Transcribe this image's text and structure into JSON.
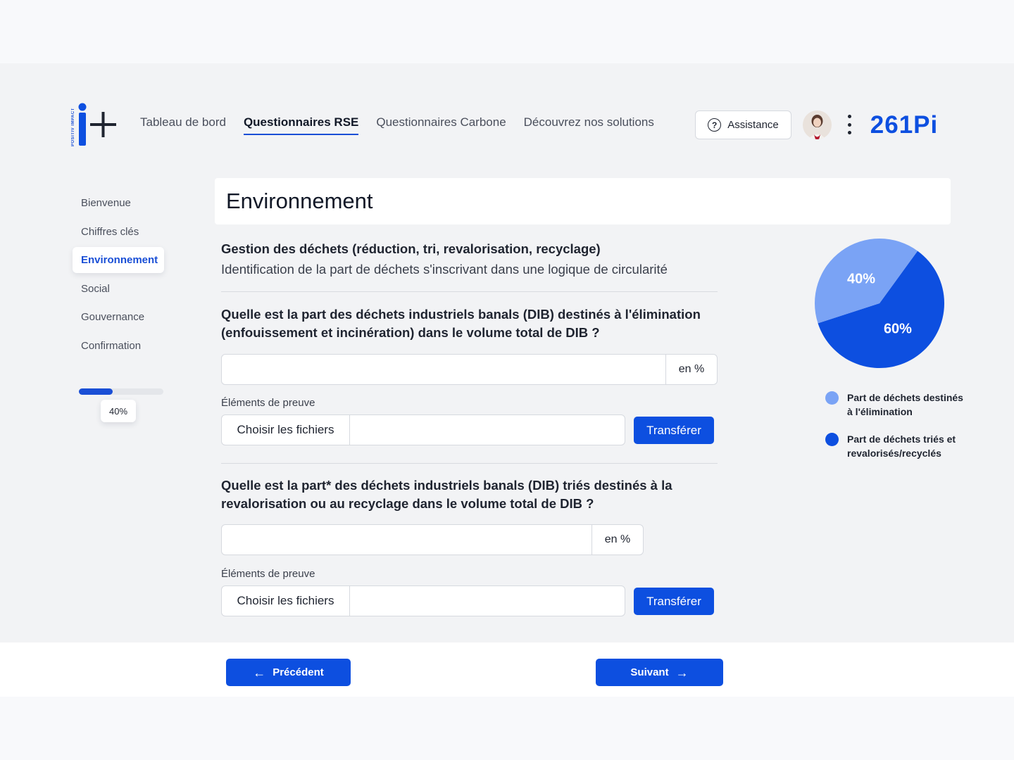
{
  "header": {
    "logo_small_text": "POSITIV IMPACT",
    "nav": [
      {
        "label": "Tableau de bord"
      },
      {
        "label": "Questionnaires RSE"
      },
      {
        "label": "Questionnaires Carbone"
      },
      {
        "label": "Découvrez nos solutions"
      }
    ],
    "active_nav": "Questionnaires RSE",
    "assistance_label": "Assistance",
    "help_icon_glyph": "?",
    "brand_text": "261Pi"
  },
  "sidebar": {
    "items": [
      {
        "label": "Bienvenue"
      },
      {
        "label": "Chiffres clés"
      },
      {
        "label": "Environnement"
      },
      {
        "label": "Social"
      },
      {
        "label": "Gouvernance"
      },
      {
        "label": "Confirmation"
      }
    ],
    "active_item": "Environnement",
    "progress_value": 0.4,
    "progress_label": "40%"
  },
  "main": {
    "title": "Environnement",
    "section_heading": "Gestion des déchets (réduction, tri, revalorisation, recyclage)",
    "section_subtitle": "Identification de la part de déchets s'inscrivant dans une logique de circularité",
    "questions": [
      {
        "text": "Quelle est la part des déchets industriels banals (DIB) destinés à l'élimination (enfouissement et incinération) dans le volume total de DIB ?",
        "input_value": "",
        "unit": "en %",
        "proof_label": "Éléments de preuve",
        "file_button": "Choisir les fichiers",
        "file_value": "",
        "transfer_label": "Transférer"
      },
      {
        "text": "Quelle est la part* des déchets industriels banals (DIB) triés destinés à la revalorisation ou au recyclage dans le volume total de DIB ?",
        "input_value": "",
        "unit": "en %",
        "proof_label": "Éléments de preuve",
        "file_button": "Choisir les fichiers",
        "file_value": "",
        "transfer_label": "Transférer"
      }
    ]
  },
  "chart_data": {
    "type": "pie",
    "title": "",
    "categories": [
      "Part de déchets destinés à l'élimination",
      "Part de déchets triés et revalorisés/recyclés"
    ],
    "values": [
      40,
      60
    ],
    "labels": [
      "40%",
      "60%"
    ],
    "colors": [
      "#7aa3f5",
      "#0d4fe0"
    ],
    "legend_position": "bottom"
  },
  "legend": [
    {
      "label": "Part de déchets destinés à l'élimination",
      "color": "#7aa3f5"
    },
    {
      "label": "Part de déchets triés et revalorisés/recyclés",
      "color": "#0d4fe0"
    }
  ],
  "footer": {
    "prev_label": "Précédent",
    "next_label": "Suivant"
  },
  "colors": {
    "accent": "#0d4fe0",
    "accent_light": "#7aa3f5",
    "background": "#f2f3f5"
  }
}
